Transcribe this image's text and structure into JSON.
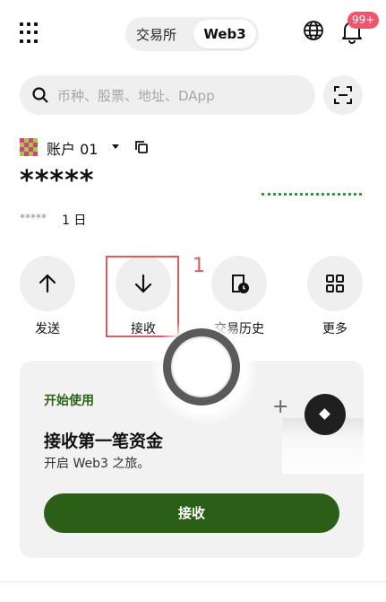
{
  "header": {
    "tabs": [
      {
        "label": "交易所",
        "active": false
      },
      {
        "label": "Web3",
        "active": true
      }
    ],
    "notification_badge": "99+",
    "icons": [
      "apps-grid-icon",
      "globe-icon",
      "bell-icon"
    ]
  },
  "search": {
    "placeholder": "币种、股票、地址、DApp",
    "value": "",
    "scan_icon": "scan-icon"
  },
  "account": {
    "name": "账户 01",
    "balance": "*****",
    "change_masked": "*****",
    "period": "1 日",
    "spark_color": "#2f9a3a"
  },
  "actions": [
    {
      "label": "发送",
      "icon": "arrow-up-icon"
    },
    {
      "label": "接收",
      "icon": "arrow-down-icon"
    },
    {
      "label": "交易历史",
      "icon": "history-icon"
    },
    {
      "label": "更多",
      "icon": "grid-icon"
    }
  ],
  "annotation": {
    "number": "1",
    "color": "#e35a5a"
  },
  "card": {
    "kicker": "开始使用",
    "title": "接收第一笔资金",
    "subtitle": "开启 Web3 之旅。",
    "button_label": "接收",
    "accent": "#2b5f18"
  }
}
